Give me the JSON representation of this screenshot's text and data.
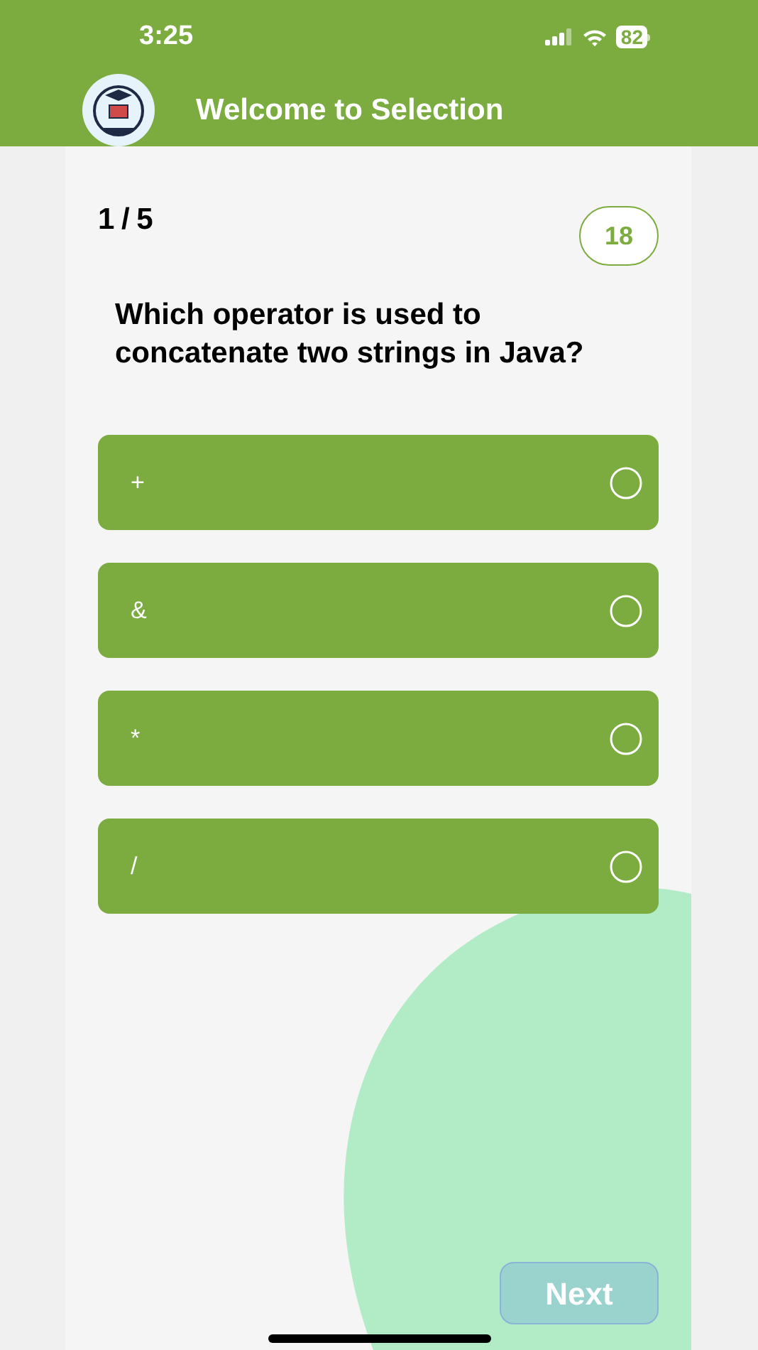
{
  "status_bar": {
    "time": "3:25",
    "battery": "82"
  },
  "header": {
    "title": "Welcome to Selection"
  },
  "quiz": {
    "progress": "1 / 5",
    "timer": "18",
    "question": "Which operator is used to concatenate two strings in Java?",
    "options": [
      {
        "label": "+",
        "selected": false
      },
      {
        "label": "&",
        "selected": false
      },
      {
        "label": "*",
        "selected": false
      },
      {
        "label": "/",
        "selected": false
      }
    ]
  },
  "next_button": {
    "label": "Next",
    "disabled": true
  }
}
